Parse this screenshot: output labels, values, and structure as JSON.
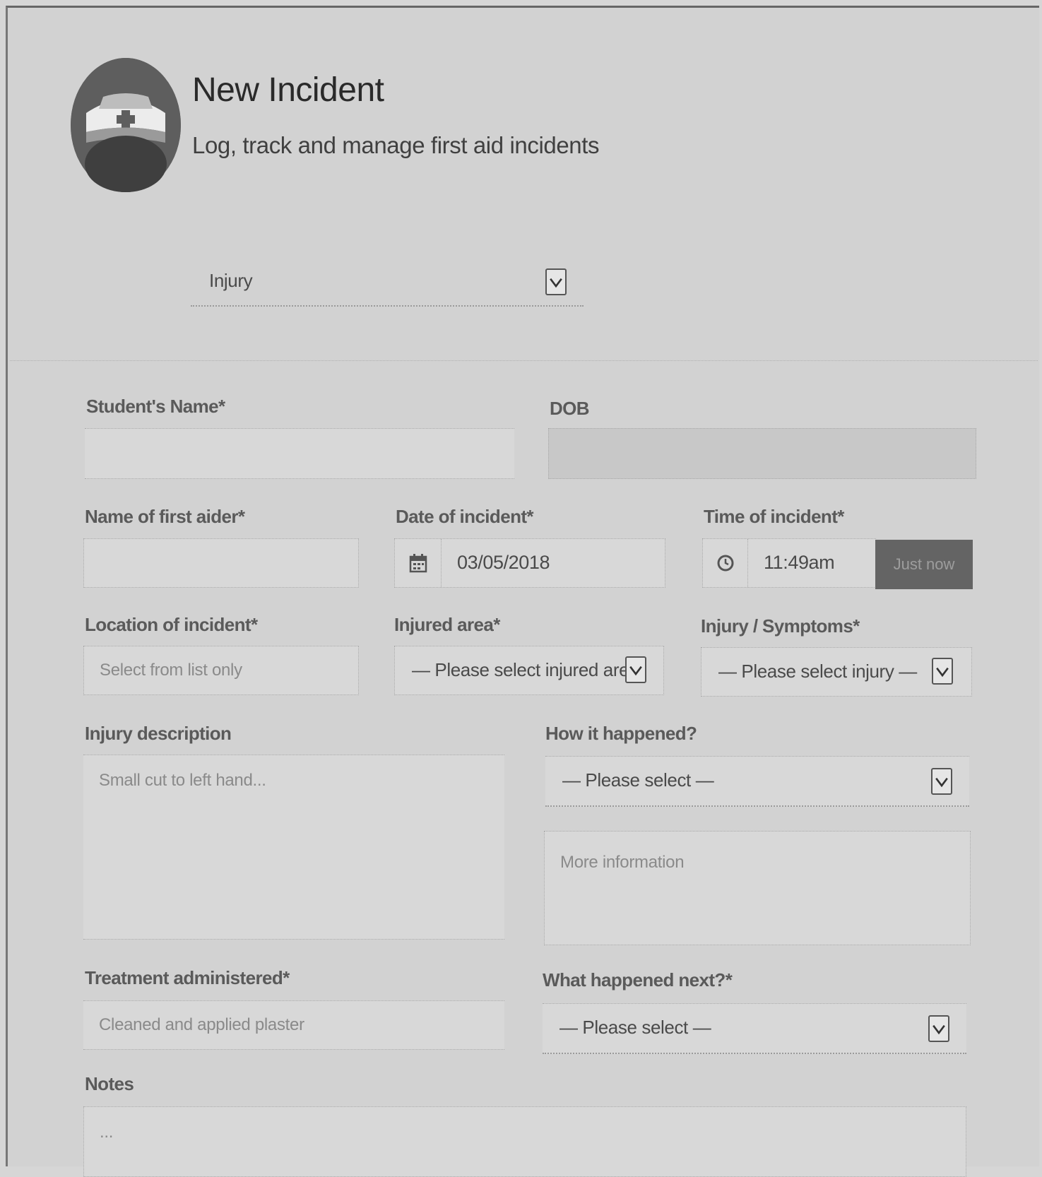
{
  "header": {
    "title": "New Incident",
    "subtitle": "Log, track and manage first aid incidents",
    "logo_icon": "first-aid-nurse-icon"
  },
  "incident_type": {
    "value": "Injury"
  },
  "form": {
    "student_name": {
      "label": "Student's Name*",
      "value": ""
    },
    "dob": {
      "label": "DOB",
      "value": ""
    },
    "first_aider": {
      "label": "Name of first aider*",
      "value": ""
    },
    "date": {
      "label": "Date of incident*",
      "value": "03/05/2018",
      "icon": "calendar-icon"
    },
    "time": {
      "label": "Time of incident*",
      "value": "11:49am",
      "icon": "clock-icon",
      "button": "Just now"
    },
    "location": {
      "label": "Location of incident*",
      "placeholder": "Select from list only"
    },
    "injured_area": {
      "label": "Injured area*",
      "value": "— Please select injured are"
    },
    "symptoms": {
      "label": "Injury / Symptoms*",
      "value": "— Please select injury —"
    },
    "injury_description": {
      "label": "Injury description",
      "placeholder": "Small cut to left hand..."
    },
    "how_happened": {
      "label": "How it happened?",
      "value": "— Please select —",
      "more_placeholder": "More information"
    },
    "treatment": {
      "label": "Treatment administered*",
      "placeholder": "Cleaned and applied plaster"
    },
    "what_next": {
      "label": "What happened next?*",
      "value": "— Please select —"
    },
    "notes": {
      "label": "Notes",
      "placeholder": "..."
    }
  }
}
